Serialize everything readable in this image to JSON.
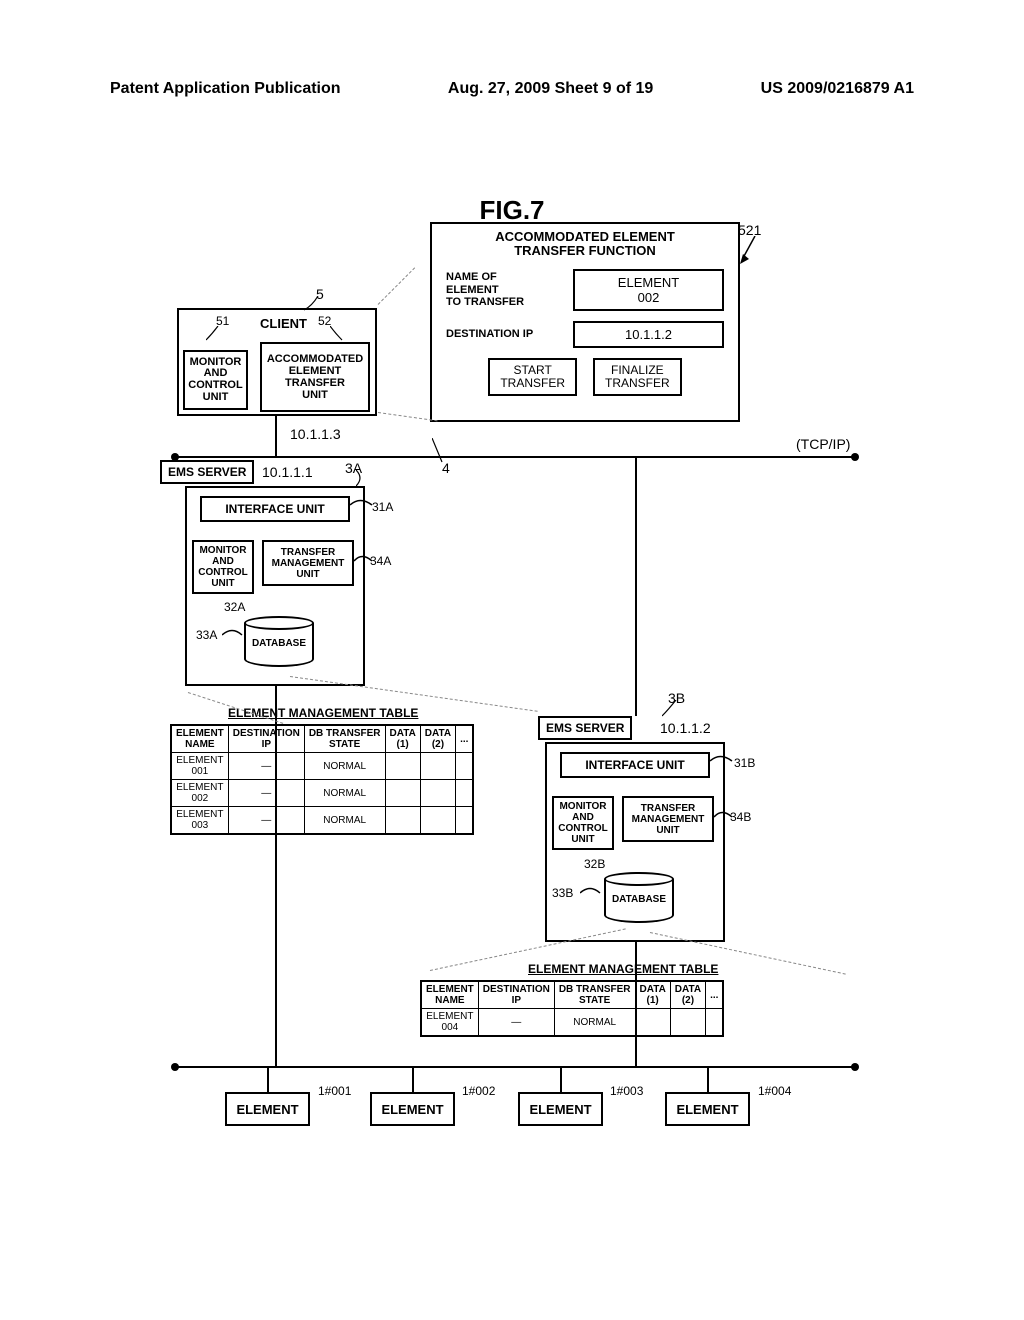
{
  "header": {
    "left": "Patent Application Publication",
    "center": "Aug. 27, 2009 Sheet 9 of 19",
    "right": "US 2009/0216879 A1"
  },
  "figure_title": "FIG.7",
  "client": {
    "title": "CLIENT",
    "mcu": "MONITOR\nAND\nCONTROL\nUNIT",
    "aetu": "ACCOMMODATED\nELEMENT\nTRANSFER\nUNIT",
    "ip": "10.1.1.3",
    "ref_5": "5",
    "ref_51": "51",
    "ref_52": "52"
  },
  "transfer_panel": {
    "title": "ACCOMMODATED ELEMENT\nTRANSFER FUNCTION",
    "ref_521": "521",
    "row1_label": "NAME OF\nELEMENT\nTO TRANSFER",
    "row1_value": "ELEMENT\n002",
    "row2_label": "DESTINATION IP",
    "row2_value": "10.1.1.2",
    "btn_start": "START\nTRANSFER",
    "btn_finalize": "FINALIZE\nTRANSFER"
  },
  "tcpip": "(TCP/IP)",
  "ems_a": {
    "tag": "EMS SERVER",
    "ip": "10.1.1.1",
    "ref_3A": "3A",
    "ref_4": "4",
    "interface": "INTERFACE UNIT",
    "ref_31A": "31A",
    "mcu": "MONITOR\nAND\nCONTROL\nUNIT",
    "tmu": "TRANSFER\nMANAGEMENT\nUNIT",
    "ref_34A": "34A",
    "ref_32A": "32A",
    "db": "DATABASE",
    "ref_33A": "33A"
  },
  "ems_b": {
    "tag": "EMS SERVER",
    "ip": "10.1.1.2",
    "ref_3B": "3B",
    "interface": "INTERFACE UNIT",
    "ref_31B": "31B",
    "mcu": "MONITOR\nAND\nCONTROL\nUNIT",
    "tmu": "TRANSFER\nMANAGEMENT\nUNIT",
    "ref_34B": "34B",
    "ref_32B": "32B",
    "db": "DATABASE",
    "ref_33B": "33B"
  },
  "table_a": {
    "title": "ELEMENT MANAGEMENT TABLE",
    "headers": [
      "ELEMENT\nNAME",
      "DESTINATION\nIP",
      "DB TRANSFER\nSTATE",
      "DATA\n(1)",
      "DATA\n(2)",
      "..."
    ],
    "rows": [
      [
        "ELEMENT\n001",
        "—",
        "NORMAL",
        "",
        "",
        ""
      ],
      [
        "ELEMENT\n002",
        "—",
        "NORMAL",
        "",
        "",
        ""
      ],
      [
        "ELEMENT\n003",
        "—",
        "NORMAL",
        "",
        "",
        ""
      ]
    ]
  },
  "table_b": {
    "title": "ELEMENT MANAGEMENT TABLE",
    "headers": [
      "ELEMENT\nNAME",
      "DESTINATION\nIP",
      "DB TRANSFER\nSTATE",
      "DATA\n(1)",
      "DATA\n(2)",
      "..."
    ],
    "rows": [
      [
        "ELEMENT\n004",
        "—",
        "NORMAL",
        "",
        "",
        ""
      ]
    ]
  },
  "elements": {
    "e1": "ELEMENT",
    "r1": "1#001",
    "e2": "ELEMENT",
    "r2": "1#002",
    "e3": "ELEMENT",
    "r3": "1#003",
    "e4": "ELEMENT",
    "r4": "1#004"
  }
}
